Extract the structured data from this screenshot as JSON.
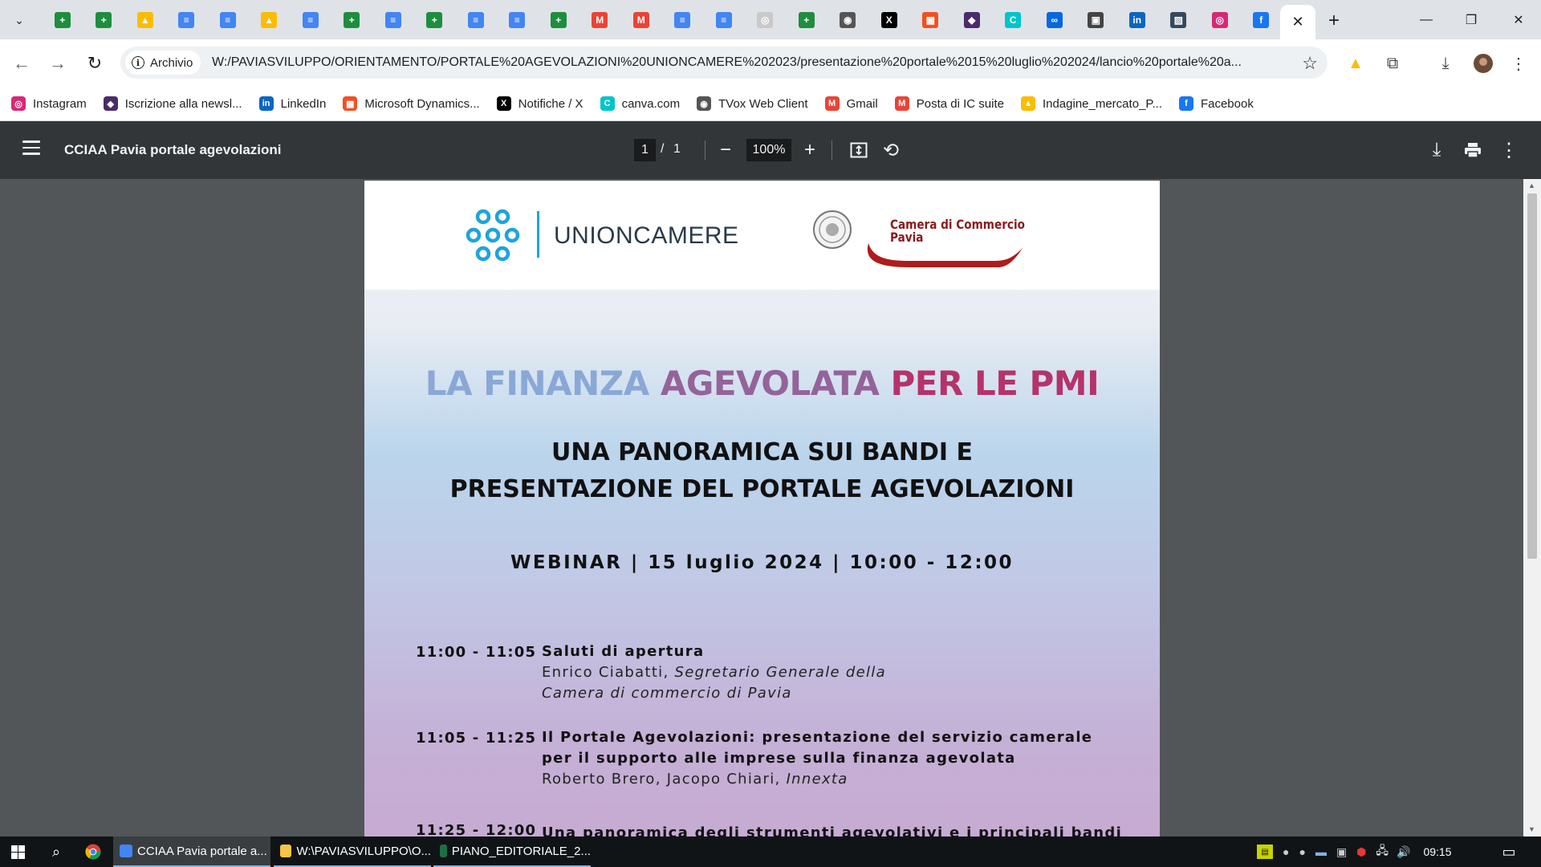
{
  "browser": {
    "tabs": [
      {
        "icon": "google-sheets-icon",
        "color": "#1e8e3e",
        "glyph": "+"
      },
      {
        "icon": "google-sheets-icon",
        "color": "#1e8e3e",
        "glyph": "+"
      },
      {
        "icon": "google-drive-icon",
        "color": "#fbbc04",
        "glyph": "▲"
      },
      {
        "icon": "google-docs-icon",
        "color": "#4285f4",
        "glyph": "≡"
      },
      {
        "icon": "google-docs-icon",
        "color": "#4285f4",
        "glyph": "≡"
      },
      {
        "icon": "google-drive-icon",
        "color": "#fbbc04",
        "glyph": "▲"
      },
      {
        "icon": "google-docs-icon",
        "color": "#4285f4",
        "glyph": "≡"
      },
      {
        "icon": "google-sheets-icon",
        "color": "#1e8e3e",
        "glyph": "+"
      },
      {
        "icon": "google-docs-icon",
        "color": "#4285f4",
        "glyph": "≡"
      },
      {
        "icon": "google-sheets-icon",
        "color": "#1e8e3e",
        "glyph": "+"
      },
      {
        "icon": "google-docs-icon",
        "color": "#4285f4",
        "glyph": "≡"
      },
      {
        "icon": "google-docs-icon",
        "color": "#4285f4",
        "glyph": "≡"
      },
      {
        "icon": "google-sheets-icon",
        "color": "#1e8e3e",
        "glyph": "+"
      },
      {
        "icon": "gmail-icon",
        "color": "#ea4335",
        "glyph": "M"
      },
      {
        "icon": "gmail-icon",
        "color": "#ea4335",
        "glyph": "M"
      },
      {
        "icon": "google-docs-icon",
        "color": "#4285f4",
        "glyph": "≡"
      },
      {
        "icon": "google-docs-icon",
        "color": "#4285f4",
        "glyph": "≡"
      },
      {
        "icon": "globe-icon",
        "color": "#c9c9c9",
        "glyph": "◎"
      },
      {
        "icon": "google-sheets-icon",
        "color": "#1e8e3e",
        "glyph": "+"
      },
      {
        "icon": "tvox-icon",
        "color": "#555555",
        "glyph": "◉"
      },
      {
        "icon": "x-icon",
        "color": "#000000",
        "glyph": "X"
      },
      {
        "icon": "microsoft-icon",
        "color": "#f25022",
        "glyph": "▦"
      },
      {
        "icon": "newsletter-icon",
        "color": "#4b2b6b",
        "glyph": "◆"
      },
      {
        "icon": "canva-icon",
        "color": "#00c4cc",
        "glyph": "C"
      },
      {
        "icon": "meta-icon",
        "color": "#0668e1",
        "glyph": "∞"
      },
      {
        "icon": "document-icon",
        "color": "#444444",
        "glyph": "▣"
      },
      {
        "icon": "linkedin-icon",
        "color": "#0a66c2",
        "glyph": "in"
      },
      {
        "icon": "image-icon",
        "color": "#34495e",
        "glyph": "▨"
      },
      {
        "icon": "instagram-icon",
        "color": "#d62976",
        "glyph": "◎"
      },
      {
        "icon": "facebook-icon",
        "color": "#1877f2",
        "glyph": "f"
      }
    ],
    "active_tab_close": "✕",
    "new_tab": "+",
    "window_controls": {
      "minimize": "—",
      "restore": "❐",
      "close": "✕"
    },
    "security_chip": "Archivio",
    "url": "W:/PAVIASVILUPPO/ORIENTAMENTO/PORTALE%20AGEVOLAZIONI%20UNIONCAMERE%202023/presentazione%20portale%2015%20luglio%202024/lancio%20portale%20a..."
  },
  "bookmarks": [
    {
      "label": "Instagram",
      "icon": "instagram-icon",
      "color": "#d62976",
      "glyph": "◎"
    },
    {
      "label": "Iscrizione alla newsl...",
      "icon": "newsletter-icon",
      "color": "#4b2b6b",
      "glyph": "◆"
    },
    {
      "label": "LinkedIn",
      "icon": "linkedin-icon",
      "color": "#0a66c2",
      "glyph": "in"
    },
    {
      "label": "Microsoft Dynamics...",
      "icon": "microsoft-icon",
      "color": "#f25022",
      "glyph": "▦"
    },
    {
      "label": "Notifiche / X",
      "icon": "x-icon",
      "color": "#000000",
      "glyph": "X"
    },
    {
      "label": "canva.com",
      "icon": "canva-icon",
      "color": "#00c4cc",
      "glyph": "C"
    },
    {
      "label": "TVox Web Client",
      "icon": "tvox-icon",
      "color": "#555555",
      "glyph": "◉"
    },
    {
      "label": "Gmail",
      "icon": "gmail-icon",
      "color": "#ea4335",
      "glyph": "M"
    },
    {
      "label": "Posta di IC suite",
      "icon": "gmail-icon",
      "color": "#ea4335",
      "glyph": "M"
    },
    {
      "label": "Indagine_mercato_P...",
      "icon": "google-drive-icon",
      "color": "#fbbc04",
      "glyph": "▲"
    },
    {
      "label": "Facebook",
      "icon": "facebook-icon",
      "color": "#1877f2",
      "glyph": "f"
    }
  ],
  "pdf": {
    "title": "CCIAA Pavia portale agevolazioni",
    "page_current": "1",
    "page_separator": "/",
    "page_total": "1",
    "zoom": "100%"
  },
  "document": {
    "unioncamere": "UNIONCAMERE",
    "ccp_line1": "Camera di Commercio",
    "ccp_line2": "Pavia",
    "title_part1": "LA FINANZA ",
    "title_part2": "AGEVOLATA ",
    "title_part3": "PER LE PMI",
    "subtitle_line1": "UNA PANORAMICA SUI BANDI E",
    "subtitle_line2": "PRESENTAZIONE DEL PORTALE AGEVOLAZIONI",
    "webinar": "WEBINAR | 15 luglio 2024 | 10:00 - 12:00",
    "agenda": [
      {
        "time": "11:00 - 11:05",
        "title": "Saluti di apertura",
        "line2_name": "Enrico Ciabatti, ",
        "line2_role": "Segretario Generale della",
        "line3_role": "Camera di commercio di Pavia"
      },
      {
        "time": "11:05 - 11:25",
        "title_l1": "Il Portale Agevolazioni: presentazione del servizio camerale",
        "title_l2": "per il supporto alle imprese sulla finanza agevolata",
        "speakers": "Roberto Brero, Jacopo Chiari, ",
        "org": "Innexta"
      },
      {
        "time": "11:25 - 12:00",
        "title": "Una panoramica degli strumenti agevolativi e i principali bandi"
      }
    ]
  },
  "taskbar": {
    "apps": [
      {
        "label": "CCIAA Pavia portale a...",
        "icon": "chrome-icon",
        "color": "#4285f4"
      },
      {
        "label": "W:\\PAVIASVILUPPO\\O...",
        "icon": "folder-icon",
        "color": "#f4c542"
      },
      {
        "label": "PIANO_EDITORIALE_2...",
        "icon": "excel-icon",
        "color": "#1d6f42"
      }
    ],
    "clock": "09:15"
  }
}
